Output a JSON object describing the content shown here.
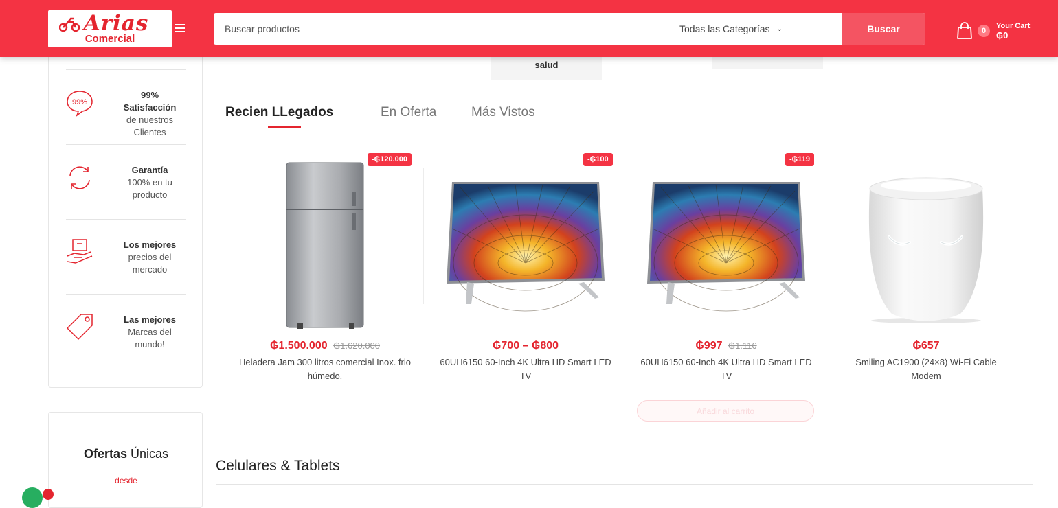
{
  "brand": {
    "logo_main": "Arias",
    "logo_sub": "Comercial",
    "color": "#f43343",
    "accent": "#e4252f"
  },
  "header": {
    "menu_icon": "hamburger-icon",
    "search": {
      "placeholder": "Buscar productos",
      "value": ""
    },
    "category_select": "Todas las Categorías",
    "search_button": "Buscar",
    "cart": {
      "icon": "shopping-bag-icon",
      "count": "0",
      "label": "Your Cart",
      "total": "₲0"
    }
  },
  "category_remnant": {
    "label": "salud"
  },
  "features": [
    {
      "icon": "satisfaction-99-icon",
      "title": "99% Satisfacción",
      "desc": "de nuestros Clientes"
    },
    {
      "icon": "refresh-icon",
      "title": "Garantía",
      "desc": "100% en tu producto"
    },
    {
      "icon": "price-hand-icon",
      "title": "Los mejores",
      "desc": "precios del mercado"
    },
    {
      "icon": "tag-icon",
      "title": "Las mejores",
      "desc": "Marcas del mundo!"
    }
  ],
  "offers": {
    "title_a": "Ofertas",
    "title_b": "Únicas",
    "desde": "desde"
  },
  "tabs": [
    {
      "label": "Recien LLegados",
      "active": true
    },
    {
      "label": "En Oferta",
      "active": false
    },
    {
      "label": "Más Vistos",
      "active": false
    }
  ],
  "products": [
    {
      "name": "Heladera Jam 300 litros comercial Inox. frio húmedo.",
      "price": "₲1.500.000",
      "old_price": "₲1.620.000",
      "discount": "-₲120.000",
      "image": "refrigerator"
    },
    {
      "name": "60UH6150 60-Inch 4K Ultra HD Smart LED TV",
      "price": "₲700 – ₲800",
      "old_price": "",
      "discount": "-₲100",
      "image": "tv"
    },
    {
      "name": "60UH6150 60-Inch 4K Ultra HD Smart LED TV",
      "price": "₲997",
      "old_price": "₲1.116",
      "discount": "-₲119",
      "image": "tv"
    },
    {
      "name": "Smiling AC1900 (24×8) Wi-Fi Cable Modem",
      "price": "₲657",
      "old_price": "",
      "discount": "",
      "image": "modem"
    }
  ],
  "add_to_cart": "Añadir al carrito",
  "section": {
    "title": "Celulares & Tablets"
  }
}
